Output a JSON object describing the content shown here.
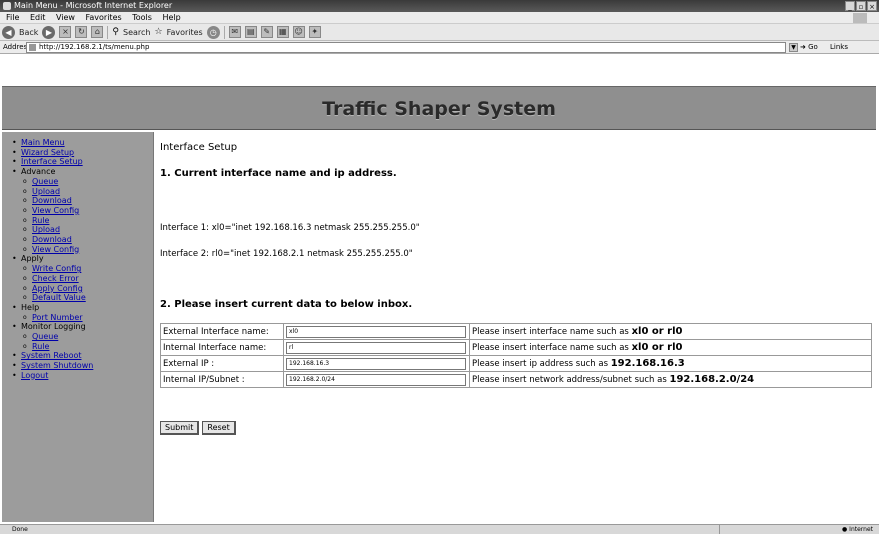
{
  "window": {
    "title": "Main Menu - Microsoft Internet Explorer"
  },
  "menubar": [
    "File",
    "Edit",
    "View",
    "Favorites",
    "Tools",
    "Help"
  ],
  "toolbar": {
    "back": "Back",
    "search": "Search",
    "favorites": "Favorites"
  },
  "address": {
    "label": "Address",
    "url": "http://192.168.2.1/ts/menu.php",
    "go": "Go",
    "links": "Links"
  },
  "header": {
    "title": "Traffic Shaper System"
  },
  "sidebar": {
    "main_menu": "Main Menu",
    "wizard_setup": "Wizard Setup",
    "interface_setup": "Interface Setup",
    "advance": "Advance",
    "queue": "Queue",
    "upload": "Upload",
    "download": "Download",
    "view_config": "View Config",
    "rule": "Rule",
    "upload2": "Upload",
    "download2": "Download",
    "view_config2": "View Config",
    "apply": "Apply",
    "write_config": "Write Config",
    "check_error": "Check Error",
    "apply_config": "Apply Config",
    "default_value": "Default Value",
    "help": "Help",
    "port_number": "Port Number",
    "monitor_logging": "Monitor Logging",
    "queue2": "Queue",
    "rule2": "Rule",
    "system_reboot": "System Reboot",
    "system_shutdown": "System Shutdown",
    "logout": "Logout"
  },
  "content": {
    "page_title": "Interface Setup",
    "section1": "1. Current interface name and ip address.",
    "interface1": "Interface 1: xl0=\"inet 192.168.16.3 netmask 255.255.255.0\"",
    "interface2": "Interface 2: rl0=\"inet 192.168.2.1 netmask 255.255.255.0\"",
    "section2": "2. Please insert current data to below inbox."
  },
  "form": {
    "rows": [
      {
        "label": "External Interface name:",
        "value": "xl0",
        "hint_text": "Please insert interface name such as ",
        "hint_example": "xl0 or rl0"
      },
      {
        "label": "Internal Interface name:",
        "value": "rl",
        "hint_text": "Please insert interface name such as ",
        "hint_example": "xl0 or rl0"
      },
      {
        "label": "External IP :",
        "value": "192.168.16.3",
        "hint_text": "Please insert ip address such as ",
        "hint_example": "192.168.16.3"
      },
      {
        "label": "Internal IP/Subnet :",
        "value": "192.168.2.0/24",
        "hint_text": "Please insert network address/subnet such as ",
        "hint_example": "192.168.2.0/24"
      }
    ],
    "submit": "Submit",
    "reset": "Reset"
  },
  "statusbar": {
    "status": "Done",
    "zone": "Internet"
  }
}
